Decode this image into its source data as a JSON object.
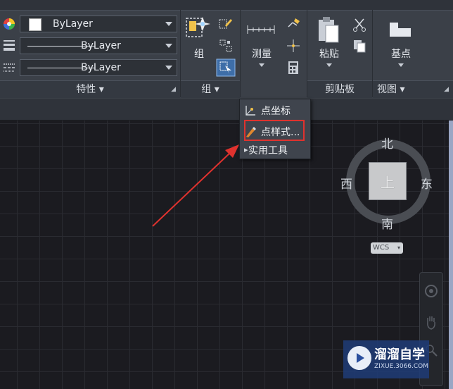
{
  "ribbon": {
    "properties": {
      "color_value": "ByLayer",
      "linetype_value": "ByLayer",
      "lineweight_value": "ByLayer",
      "footer_label": "特性"
    },
    "groups": {
      "group_button_label": "组",
      "footer_label": "组"
    },
    "utilities": {
      "measure_label": "测量"
    },
    "clipboard": {
      "paste_label": "粘贴",
      "footer_label": "剪贴板"
    },
    "view": {
      "base_point_label": "基点",
      "footer_label": "视图"
    }
  },
  "dropdown_menu": {
    "items": [
      {
        "label": "点坐标",
        "icon": "point-coordinate-icon"
      },
      {
        "label": "点样式...",
        "icon": "point-style-icon"
      },
      {
        "label": "实用工具",
        "icon": "utilities-icon"
      }
    ]
  },
  "viewcube": {
    "north": "北",
    "south": "南",
    "east": "东",
    "west": "西",
    "face": "上",
    "wcs_label": "WCS"
  },
  "watermark": {
    "title": "溜溜自学",
    "subtitle": "ZIXUE.3066.COM"
  },
  "colors": {
    "ribbon_bg": "#3b4048",
    "canvas_bg": "#1b1b20",
    "highlight_red": "#e0322e"
  }
}
